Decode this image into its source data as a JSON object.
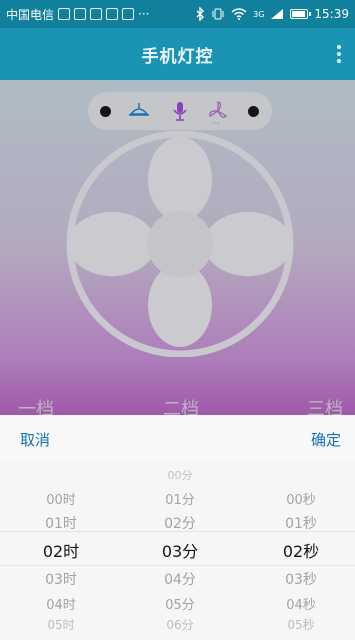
{
  "status_bar": {
    "carrier": "中国电信",
    "more": "···",
    "network": "3G",
    "time": "15:39"
  },
  "app_bar": {
    "title": "手机灯控"
  },
  "mode_switcher": {
    "icons": [
      "lamp-icon",
      "microphone-icon",
      "fan-icon"
    ],
    "active_icon_dots": "···"
  },
  "gear_labels": [
    "一档",
    "二档",
    "三档"
  ],
  "picker": {
    "cancel_label": "取消",
    "confirm_label": "确定",
    "hours": [
      "00时",
      "01时",
      "02时",
      "03时",
      "04时",
      "05时"
    ],
    "minutes": [
      "00分",
      "01分",
      "02分",
      "03分",
      "04分",
      "05分",
      "06分"
    ],
    "seconds": [
      "00秒",
      "01秒",
      "02秒",
      "03秒",
      "04秒",
      "05秒"
    ],
    "selected": {
      "hour": "02时",
      "minute": "03分",
      "second": "02秒"
    }
  },
  "colors": {
    "status_bar": "#11809c",
    "app_bar": "#1a93b5",
    "accent_blue": "#1670b8",
    "purple": "#8a3fc0"
  }
}
